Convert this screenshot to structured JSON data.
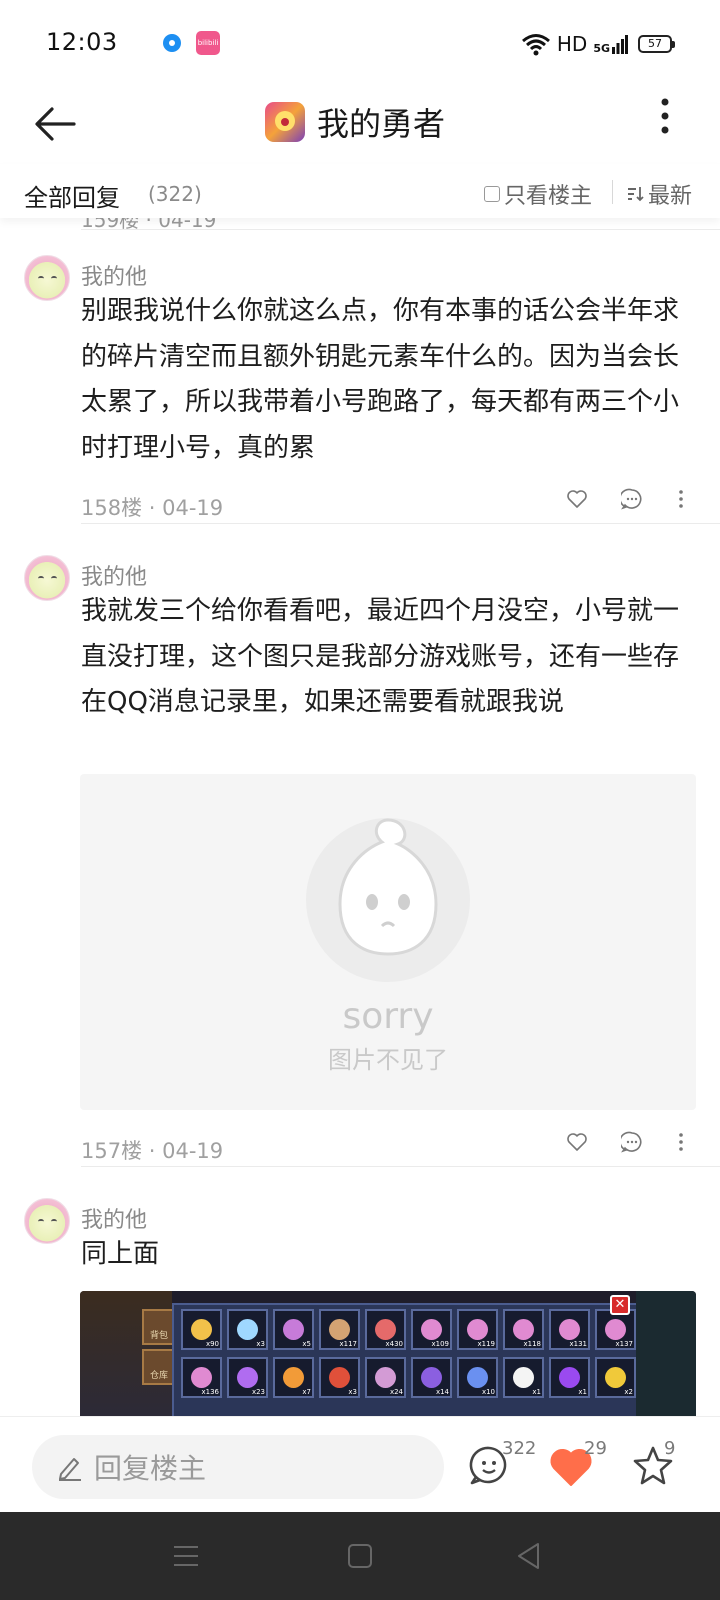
{
  "status_bar": {
    "time": "12:03",
    "network": "HD",
    "signal": "5G",
    "battery": "57",
    "app_icon_2_text": "bilibili"
  },
  "nav": {
    "title": "我的勇者"
  },
  "reply_header": {
    "title": "全部回复",
    "count": "(322)",
    "only_op_label": "只看楼主",
    "sort_label": "最新"
  },
  "previous_floor_meta": "159楼 · 04-19",
  "posts": [
    {
      "author": "我的他",
      "text": "别跟我说什么你就这么点，你有本事的话公会半年求的碎片清空而且额外钥匙元素车什么的。因为当会长太累了，所以我带着小号跑路了，每天都有两三个小时打理小号，真的累",
      "meta": "158楼 · 04-19"
    },
    {
      "author": "我的他",
      "text": "我就发三个给你看看吧，最近四个月没空，小号就一直没打理，这个图只是我部分游戏账号，还有一些存在QQ消息记录里，如果还需要看就跟我说",
      "image_missing_title": "sorry",
      "image_missing_sub": "图片不见了",
      "meta": "157楼 · 04-19"
    },
    {
      "author": "我的他",
      "text": "同上面",
      "game_tabs": [
        "背包",
        "仓库"
      ],
      "game_counts": [
        "x90",
        "x3",
        "x5",
        "x117",
        "x430",
        "x109",
        "x119",
        "x118",
        "x131",
        "x137",
        "x136",
        "x23",
        "x7",
        "x3",
        "x24",
        "x14",
        "x10",
        "x1",
        "x1",
        "x2"
      ]
    }
  ],
  "bottom_bar": {
    "reply_placeholder": "回复楼主",
    "comment_count": "322",
    "like_count": "29",
    "star_count": "9"
  },
  "colors": {
    "like_heart": "#ff6e4a",
    "text_primary": "#1e1e1e",
    "text_secondary": "#8a8a8a"
  }
}
